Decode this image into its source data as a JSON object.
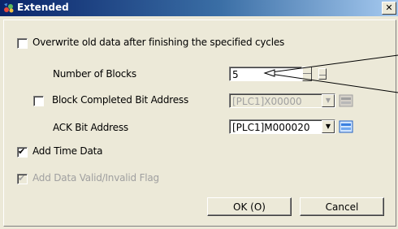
{
  "window": {
    "title": "Extended",
    "close_glyph": "✕"
  },
  "options": {
    "overwrite_label": "Overwrite old data after finishing the specified cycles",
    "overwrite_checked": false,
    "blocks_label": "Number of Blocks",
    "blocks_value": "5",
    "block_completed_label": "Block Completed Bit Address",
    "block_completed_checked": false,
    "block_completed_value": "[PLC1]X00000",
    "ack_label": "ACK Bit Address",
    "ack_value": "[PLC1]M000020",
    "add_time_label": "Add Time Data",
    "add_time_checked": true,
    "add_valid_label": "Add Data Valid/Invalid Flag",
    "add_valid_checked": true
  },
  "buttons": {
    "ok": "OK (O)",
    "cancel": "Cancel"
  },
  "icons": {
    "title": "wizard-icon",
    "address": "address-input-icon"
  },
  "colors": {
    "title_start": "#0a246a",
    "title_end": "#a6caf0",
    "face": "#ece9d8"
  }
}
